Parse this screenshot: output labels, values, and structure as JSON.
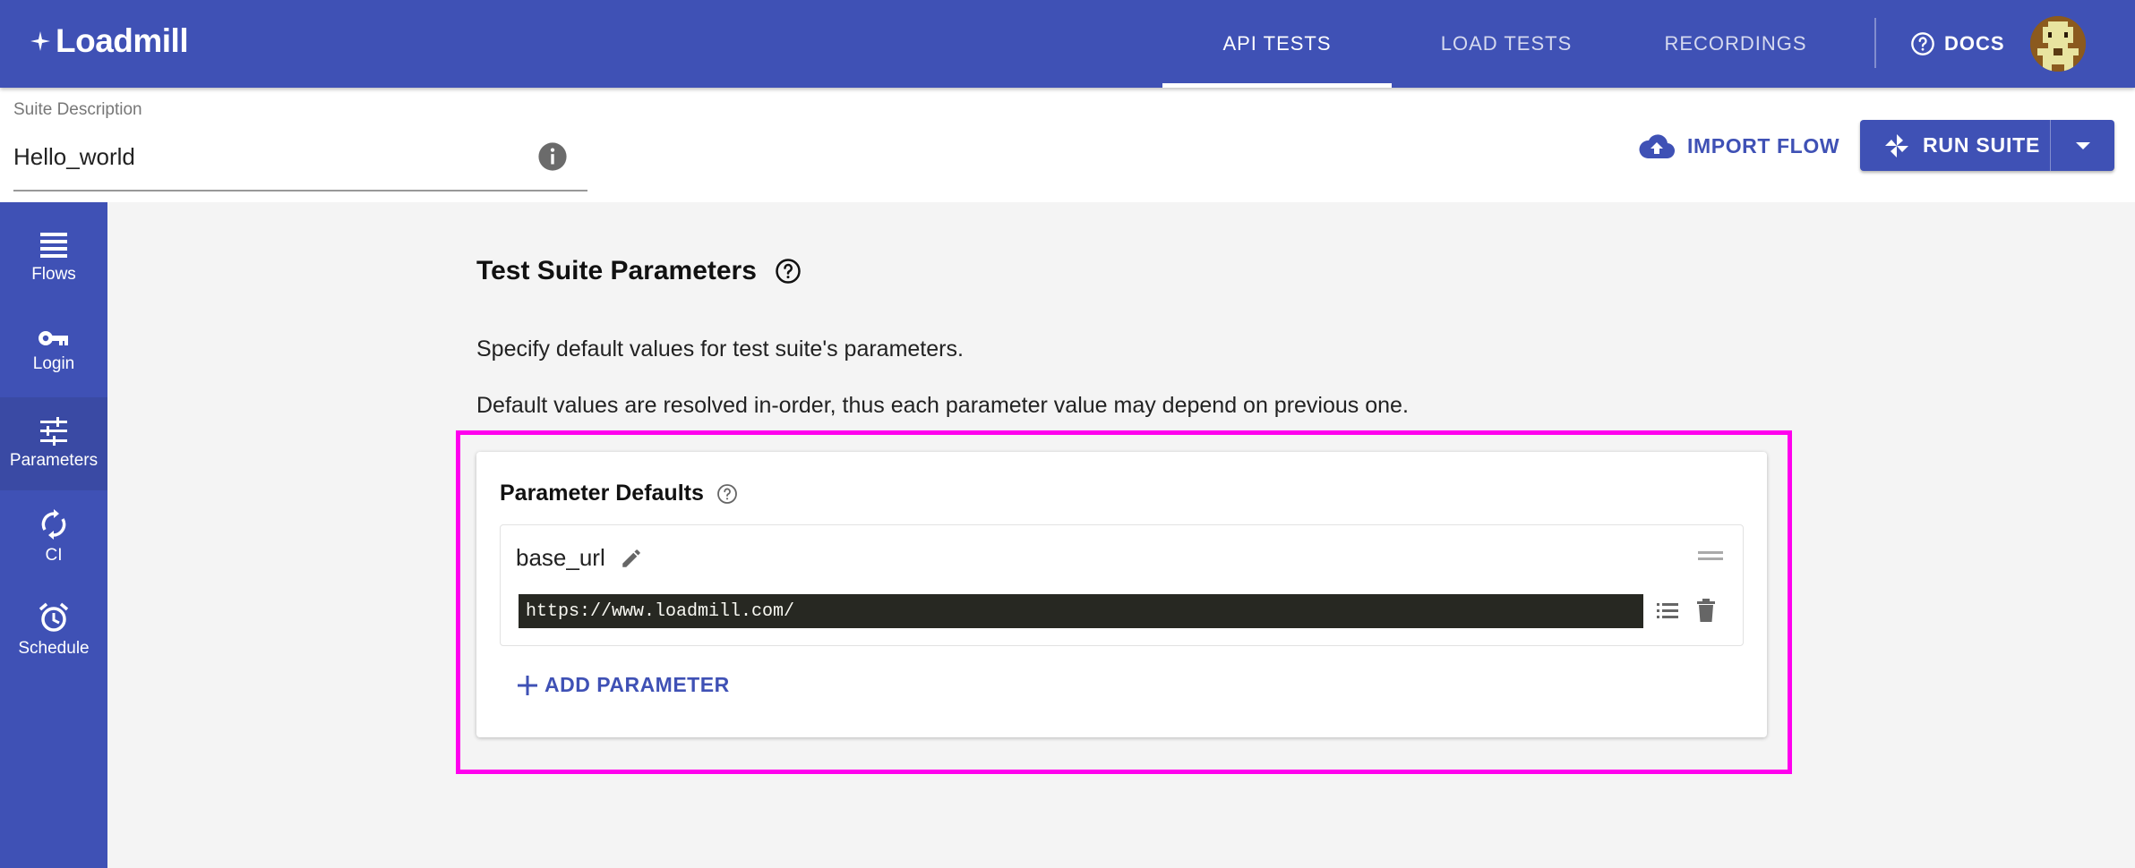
{
  "app": {
    "logo_text": "Loadmill"
  },
  "nav": {
    "tabs": [
      {
        "label": "API TESTS",
        "active": true
      },
      {
        "label": "LOAD TESTS",
        "active": false
      },
      {
        "label": "RECORDINGS",
        "active": false
      }
    ],
    "docs_label": "DOCS"
  },
  "header": {
    "description_label": "Suite Description",
    "description_value": "Hello_world",
    "import_label": "IMPORT FLOW",
    "run_label": "RUN SUITE"
  },
  "sidebar": {
    "items": [
      {
        "label": "Flows",
        "icon": "flows-icon",
        "active": false
      },
      {
        "label": "Login",
        "icon": "key-icon",
        "active": false
      },
      {
        "label": "Parameters",
        "icon": "tune-icon",
        "active": true
      },
      {
        "label": "CI",
        "icon": "sync-icon",
        "active": false
      },
      {
        "label": "Schedule",
        "icon": "alarm-icon",
        "active": false
      }
    ]
  },
  "main": {
    "title": "Test Suite Parameters",
    "paragraph_1": "Specify default values for test suite's parameters.",
    "paragraph_2": "Default values are resolved in-order, thus each parameter value may depend on previous one.",
    "card": {
      "title": "Parameter Defaults",
      "parameters": [
        {
          "name": "base_url",
          "value": "https://www.loadmill.com/"
        }
      ],
      "add_label": "ADD PARAMETER"
    }
  },
  "colors": {
    "primary": "#3f51b5",
    "highlight": "#ff00ee",
    "code_bg": "#272822"
  }
}
